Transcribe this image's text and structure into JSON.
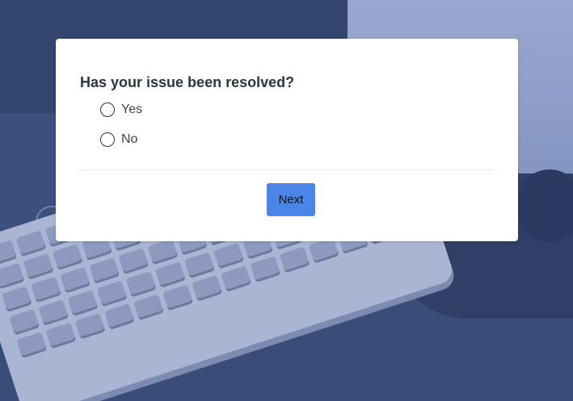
{
  "survey": {
    "question": "Has your issue been resolved?",
    "options": [
      {
        "label": "Yes",
        "selected": false
      },
      {
        "label": "No",
        "selected": false
      }
    ],
    "next_label": "Next"
  },
  "colors": {
    "background_tint": "#3d4f7c",
    "card": "#ffffff",
    "button": "#4a86e8",
    "text": "#2c3542"
  },
  "background_image": "desk-keyboard-photo"
}
